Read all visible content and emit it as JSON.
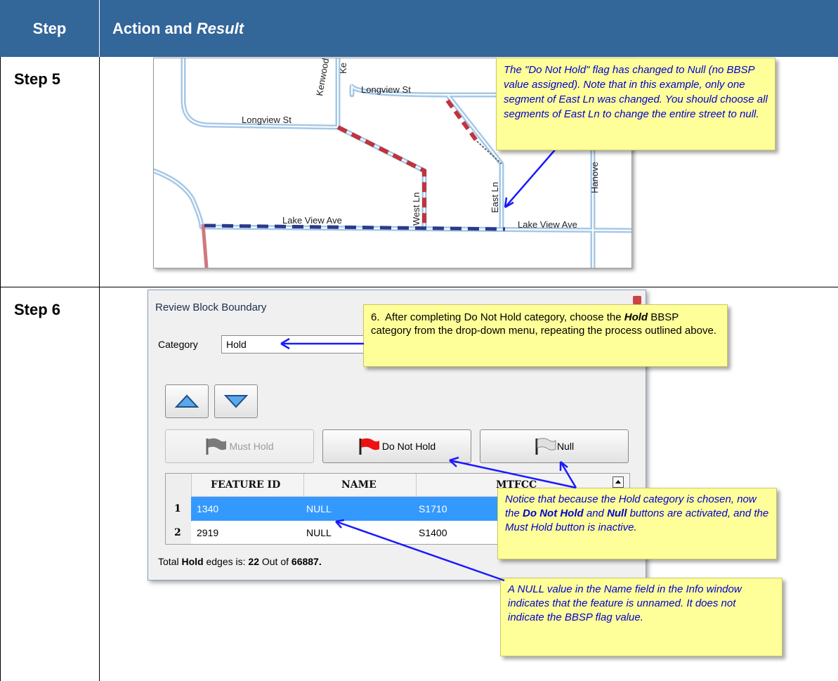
{
  "header": {
    "step_label": "Step",
    "action_label": "Action and ",
    "result_label": "Result"
  },
  "step5": {
    "label": "Step 5",
    "map": {
      "street_labels": {
        "longview_top": "Longview St",
        "longview_left": "Longview St",
        "kenwood": "Kenwood St",
        "kenwood_partial": "Ke",
        "west_ln": "West Ln",
        "east_ln": "East Ln",
        "hanover": "Hanove",
        "lake_view_left": "Lake View Ave",
        "lake_view_right": "Lake View Ave"
      }
    },
    "callout_text": "The \"Do Not Hold\" flag has changed to Null (no BBSP value assigned). Note that in this example, only one segment of East Ln was changed. You should choose all segments of East Ln to change the entire street to null."
  },
  "step6": {
    "label": "Step 6",
    "dialog": {
      "title": "Review Block Boundary",
      "category_label": "Category",
      "category_value": "Hold",
      "buttons": {
        "must_hold": "Must Hold",
        "do_not_hold": "Do Not Hold",
        "null": "Null"
      },
      "columns": [
        "FEATURE ID",
        "NAME",
        "MTFCC"
      ],
      "rows": [
        {
          "num": "1",
          "feature_id": "1340",
          "name": "NULL",
          "mtfcc": "S1710"
        },
        {
          "num": "2",
          "feature_id": "2919",
          "name": "NULL",
          "mtfcc": "S1400"
        }
      ],
      "footer": {
        "prefix": "Total ",
        "category": "Hold",
        "middle": " edges is: ",
        "count": "22",
        "out_of": " Out of ",
        "total": "66887."
      }
    },
    "callout_instruction": {
      "text1": "6.  After completing Do Not Hold category, choose the ",
      "bold": "Hold",
      "text2": " BBSP category from the drop-down menu, repeating the process outlined above."
    },
    "callout_notice": {
      "t1": "Notice that because the Hold category is chosen, now the ",
      "b1": "Do Not Hold",
      "t2": " and ",
      "b2": "Null",
      "t3": " buttons are activated, and the Must Hold button is inactive."
    },
    "callout_null": "A NULL value in the Name field in the Info window indicates that the feature is unnamed.  It does not indicate the BBSP flag value."
  },
  "colors": {
    "header_bg": "#336699",
    "callout_bg": "#ffff99",
    "callout_text": "#0000cc",
    "selected_row": "#3399ff",
    "arrow": "#1a1aff"
  }
}
